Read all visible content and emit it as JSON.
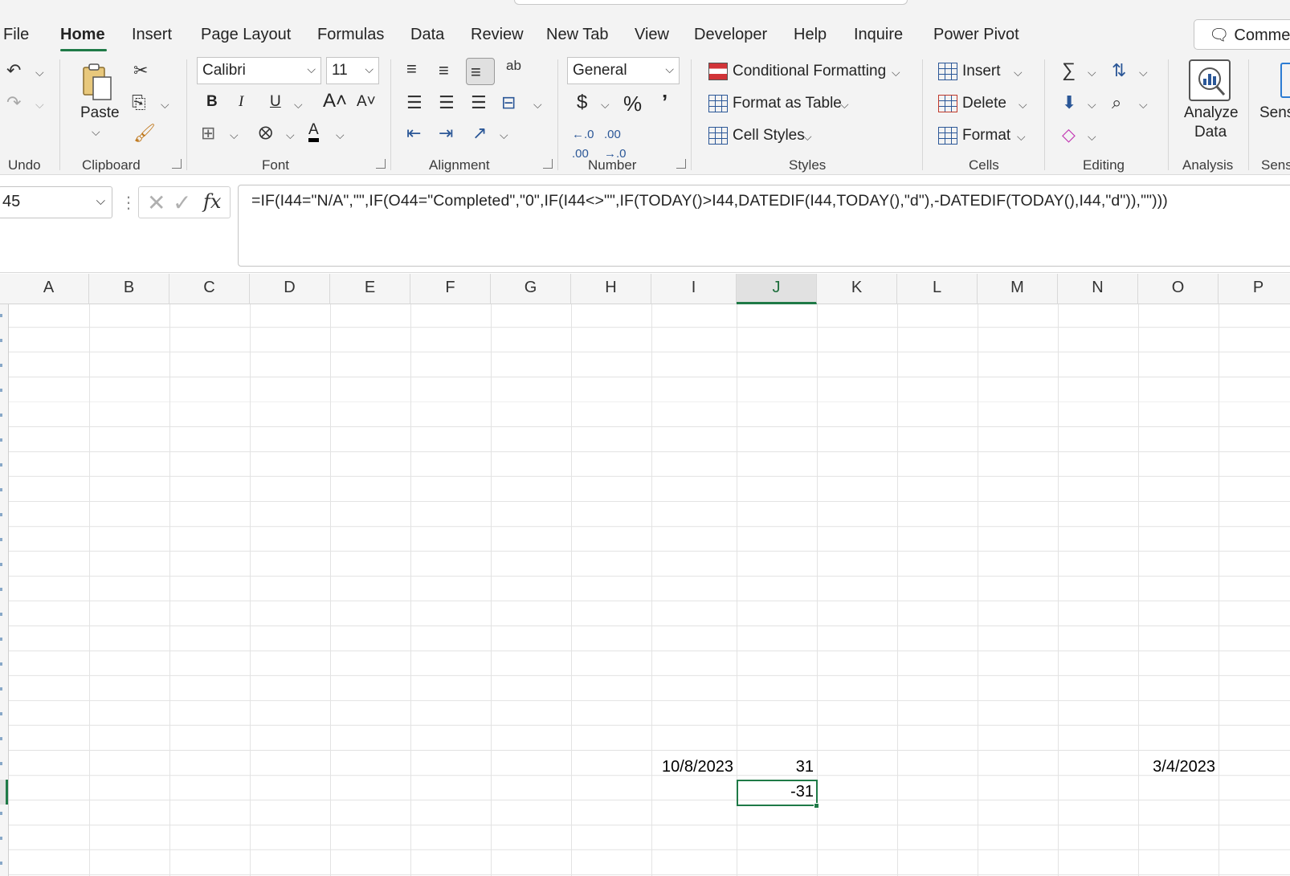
{
  "menu": {
    "tabs": [
      "File",
      "Home",
      "Insert",
      "Page Layout",
      "Formulas",
      "Data",
      "Review",
      "New Tab",
      "View",
      "Developer",
      "Help",
      "Inquire",
      "Power Pivot"
    ],
    "active_tab": "Home",
    "comments_label": "Commen"
  },
  "ribbon": {
    "groups": {
      "undo": "Undo",
      "clipboard": "Clipboard",
      "font": "Font",
      "alignment": "Alignment",
      "number": "Number",
      "styles": "Styles",
      "cells": "Cells",
      "editing": "Editing",
      "analysis": "Analysis",
      "sensitivity": "Sens"
    },
    "paste_label": "Paste",
    "font_name": "Calibri",
    "font_size": "11",
    "number_format": "General",
    "conditional_formatting": "Conditional Formatting",
    "format_as_table": "Format as Table",
    "cell_styles": "Cell Styles",
    "insert": "Insert",
    "delete": "Delete",
    "format": "Format",
    "analyze_data_line1": "Analyze",
    "analyze_data_line2": "Data",
    "sensitivity_label": "Sens",
    "bold": "B",
    "italic": "I",
    "underline": "U",
    "wrap_glyph": "ab",
    "accent_color": "#1f7a47"
  },
  "formula_bar": {
    "name_box": "45",
    "fx": "fx",
    "formula": "=IF(I44=\"N/A\",\"\",IF(O44=\"Completed\",\"0\",IF(I44<>\"\",IF(TODAY()>I44,DATEDIF(I44,TODAY(),\"d\"),-DATEDIF(TODAY(),I44,\"d\")),\"\")))"
  },
  "sheet": {
    "columns": [
      "A",
      "B",
      "C",
      "D",
      "E",
      "F",
      "G",
      "H",
      "I",
      "J",
      "K",
      "L",
      "M",
      "N",
      "O",
      "P"
    ],
    "selected_column": "J",
    "cells": {
      "I44": "10/8/2023",
      "J44": "31",
      "O44": "3/4/2023",
      "J45": "-31"
    }
  }
}
